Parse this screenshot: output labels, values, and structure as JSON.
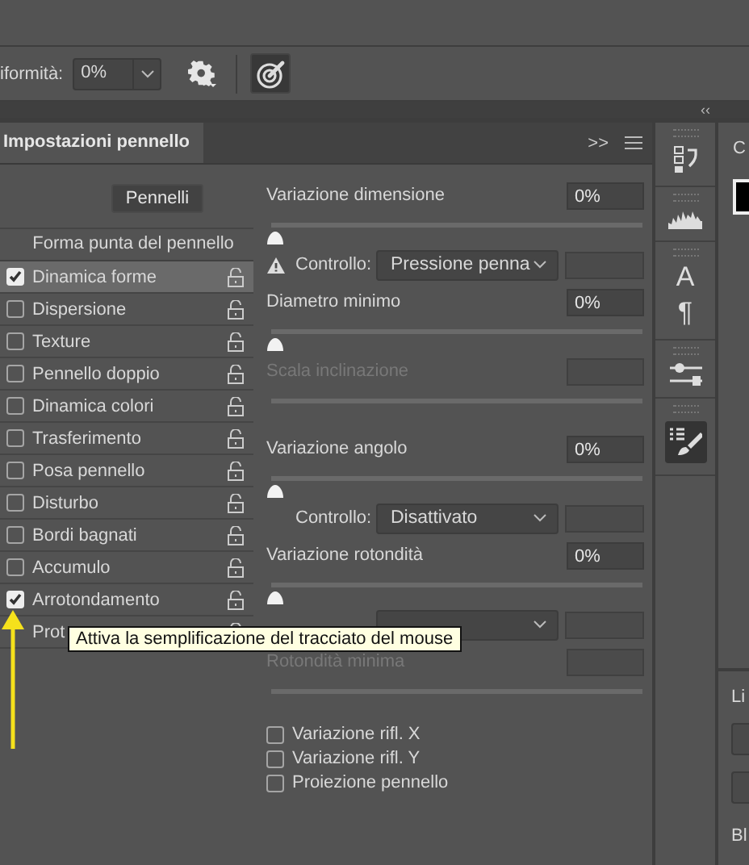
{
  "options_bar": {
    "label": "iformità:",
    "value": "0%"
  },
  "collapse_label": "‹‹",
  "panel": {
    "tab": {
      "label": "Impostazioni pennello",
      "selected": true
    },
    "more_label": ">>",
    "brushes_button": "Pennelli",
    "list_header": "Forma punta del pennello",
    "items": [
      {
        "label": "Dinamica forme",
        "checked": true,
        "selected": true
      },
      {
        "label": "Dispersione",
        "checked": false,
        "selected": false
      },
      {
        "label": "Texture",
        "checked": false,
        "selected": false
      },
      {
        "label": "Pennello doppio",
        "checked": false,
        "selected": false
      },
      {
        "label": "Dinamica colori",
        "checked": false,
        "selected": false
      },
      {
        "label": "Trasferimento",
        "checked": false,
        "selected": false
      },
      {
        "label": "Posa pennello",
        "checked": false,
        "selected": false
      },
      {
        "label": "Disturbo",
        "checked": false,
        "selected": false
      },
      {
        "label": "Bordi bagnati",
        "checked": false,
        "selected": false
      },
      {
        "label": "Accumulo",
        "checked": false,
        "selected": false
      },
      {
        "label": "Arrotondamento",
        "checked": true,
        "selected": false
      },
      {
        "label": "Prot",
        "selected": false
      }
    ],
    "settings": [
      {
        "kind": "param",
        "label": "Variazione dimensione",
        "value": "0%",
        "level": 0,
        "disabled": false
      },
      {
        "kind": "control",
        "label": "Controllo:",
        "value": "Pressione penna",
        "warning": true
      },
      {
        "kind": "param",
        "label": "Diametro minimo",
        "value": "0%",
        "level": 0,
        "disabled": false
      },
      {
        "kind": "param",
        "label": "Scala inclinazione",
        "disabled": true
      },
      {
        "kind": "param",
        "label": "Variazione angolo",
        "value": "0%",
        "level": 0,
        "disabled": false
      },
      {
        "kind": "control",
        "label": "Controllo:",
        "value": "Disattivato",
        "warning": false
      },
      {
        "kind": "param",
        "label": "Variazione rotondità",
        "value": "0%",
        "level": 0,
        "disabled": false
      },
      {
        "kind": "control",
        "warning": false
      },
      {
        "kind": "param",
        "label": "Rotondità minima",
        "disabled": true
      }
    ],
    "checkboxes": [
      {
        "label": "Variazione rifl. X",
        "checked": false
      },
      {
        "label": "Variazione rifl. Y",
        "checked": false
      },
      {
        "label": "Proiezione pennello",
        "checked": false
      }
    ]
  },
  "tooltip": "Attiva la semplificazione del tracciato del mouse",
  "icon_strip": {
    "character_glyph": "A",
    "paragraph_glyph": "¶"
  },
  "side_panel": {
    "title": "C",
    "section_label": "Li",
    "bottom_label": "Bl"
  }
}
